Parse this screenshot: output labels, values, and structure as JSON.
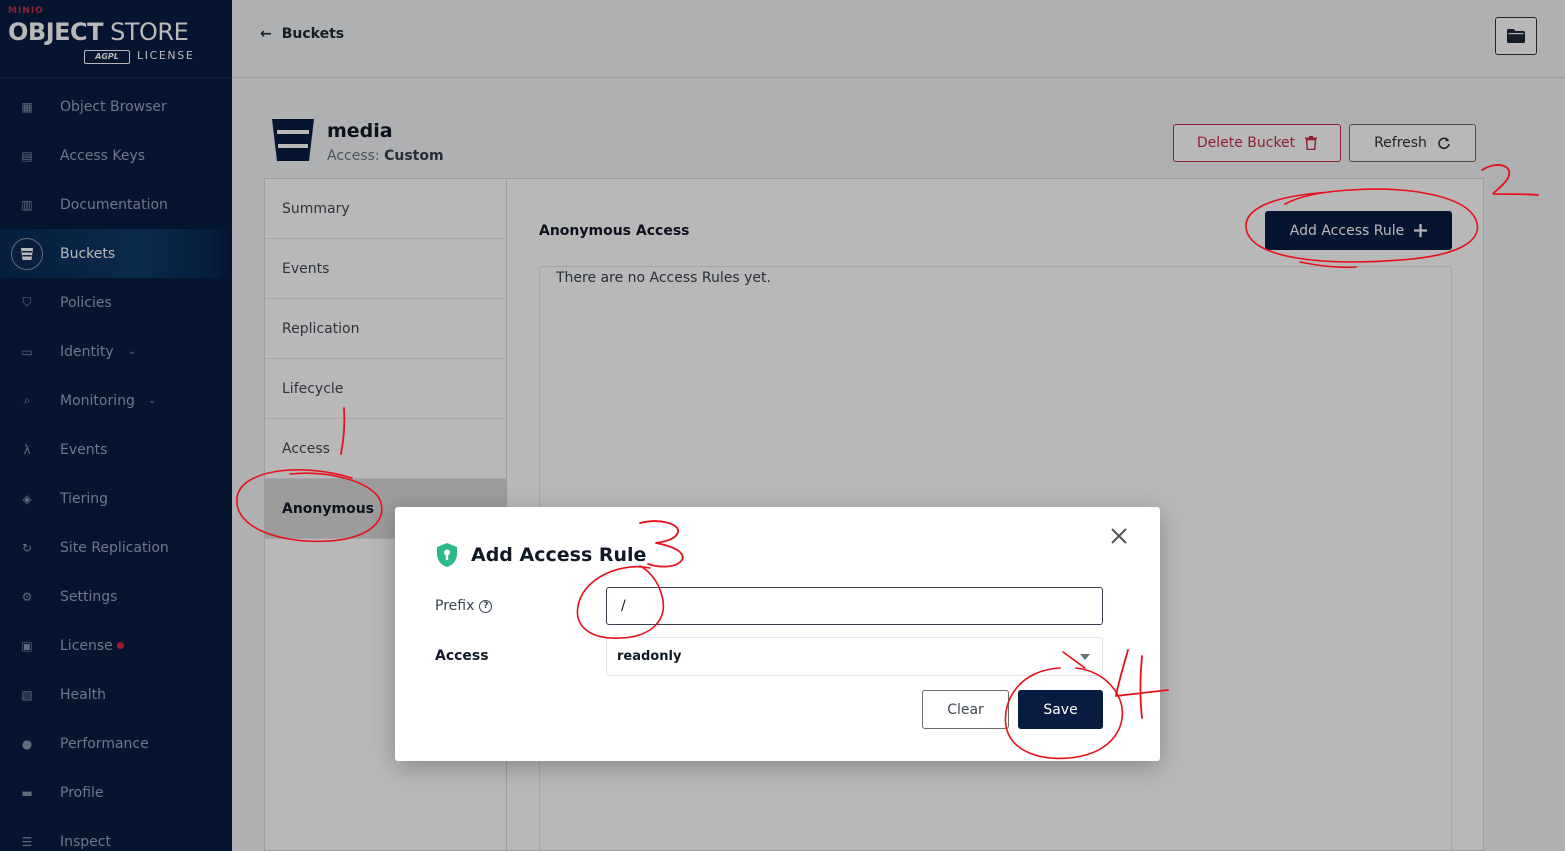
{
  "sidebar": {
    "logo": {
      "brand": "MINIO",
      "product_bold": "OBJECT",
      "product_rest": " STORE",
      "agpl": "AGPL",
      "license": "LICENSE"
    },
    "items": [
      {
        "label": "Object Browser",
        "icon": "object-browser-icon"
      },
      {
        "label": "Access Keys",
        "icon": "access-keys-icon"
      },
      {
        "label": "Documentation",
        "icon": "documentation-icon"
      },
      {
        "label": "Buckets",
        "icon": "buckets-icon",
        "active": true
      },
      {
        "label": "Policies",
        "icon": "policies-icon"
      },
      {
        "label": "Identity",
        "icon": "identity-icon",
        "has_chevron": true
      },
      {
        "label": "Monitoring",
        "icon": "monitoring-icon",
        "has_chevron": true
      },
      {
        "label": "Events",
        "icon": "lambda-icon"
      },
      {
        "label": "Tiering",
        "icon": "tiering-icon"
      },
      {
        "label": "Site Replication",
        "icon": "site-replication-icon"
      },
      {
        "label": "Settings",
        "icon": "settings-icon"
      },
      {
        "label": "License",
        "icon": "license-icon",
        "has_dot": true
      },
      {
        "label": "Health",
        "icon": "health-icon"
      },
      {
        "label": "Performance",
        "icon": "performance-icon"
      },
      {
        "label": "Profile",
        "icon": "profile-icon"
      },
      {
        "label": "Inspect",
        "icon": "inspect-icon"
      }
    ]
  },
  "topbar": {
    "back_label": "Buckets"
  },
  "bucket": {
    "name": "media",
    "access_label": "Access:",
    "access_value": "Custom",
    "delete_label": "Delete Bucket",
    "refresh_label": "Refresh"
  },
  "tabs": [
    "Summary",
    "Events",
    "Replication",
    "Lifecycle",
    "Access",
    "Anonymous"
  ],
  "active_tab": "Anonymous",
  "panel": {
    "title": "Anonymous Access",
    "add_label": "Add Access Rule",
    "empty_text": "There are no Access Rules yet."
  },
  "modal": {
    "title": "Add Access Rule",
    "prefix_label": "Prefix",
    "prefix_value": "/",
    "access_label": "Access",
    "access_value": "readonly",
    "clear_label": "Clear",
    "save_label": "Save"
  },
  "annotations": [
    "1",
    "2",
    "3",
    "4"
  ],
  "colors": {
    "sidebar_bg": "#081c42",
    "primary": "#081c42",
    "danger": "#c72c48",
    "annotation": "#e8101a",
    "shield": "#2fb88a"
  }
}
